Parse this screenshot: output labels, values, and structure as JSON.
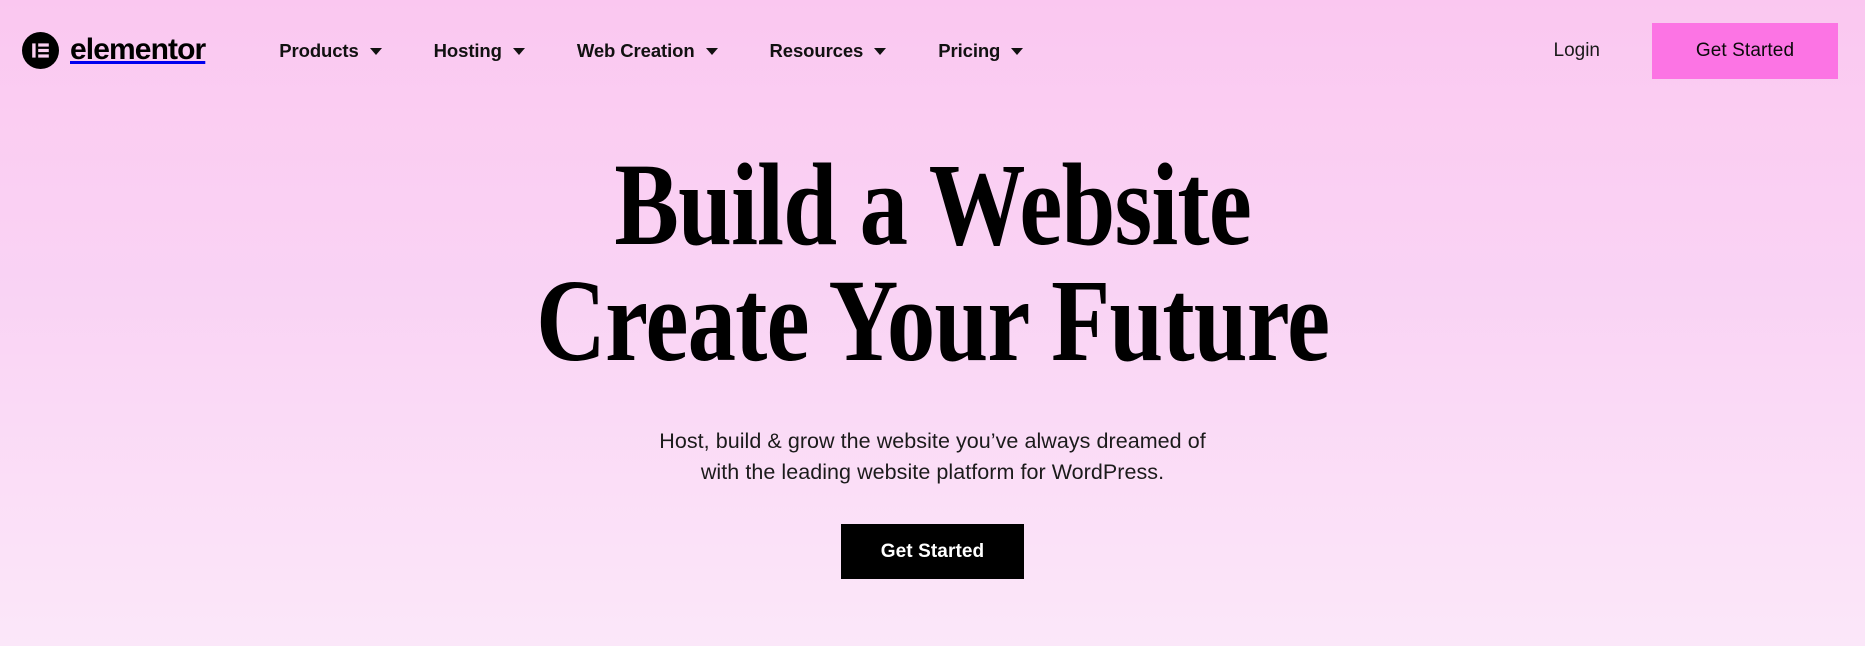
{
  "brand": {
    "name": "elementor",
    "mark_icon": "elementor-logo-icon"
  },
  "nav": {
    "items": [
      {
        "label": "Products",
        "caret_icon": "chevron-down-icon"
      },
      {
        "label": "Hosting",
        "caret_icon": "chevron-down-icon"
      },
      {
        "label": "Web Creation",
        "caret_icon": "chevron-down-icon"
      },
      {
        "label": "Resources",
        "caret_icon": "chevron-down-icon"
      },
      {
        "label": "Pricing",
        "caret_icon": "chevron-down-icon"
      }
    ]
  },
  "header_actions": {
    "login_label": "Login",
    "cta_label": "Get Started"
  },
  "hero": {
    "headline_line1": "Build a Website",
    "headline_line2": "Create Your Future",
    "subhead_line1": "Host, build & grow the website you’ve always dreamed of",
    "subhead_line2": "with the leading website platform for WordPress.",
    "cta_label": "Get Started"
  },
  "colors": {
    "background_top": "#fac7f0",
    "background_bottom": "#fbe7f9",
    "header_cta": "#fc74e4",
    "hero_cta": "#000000",
    "text": "#000000"
  }
}
